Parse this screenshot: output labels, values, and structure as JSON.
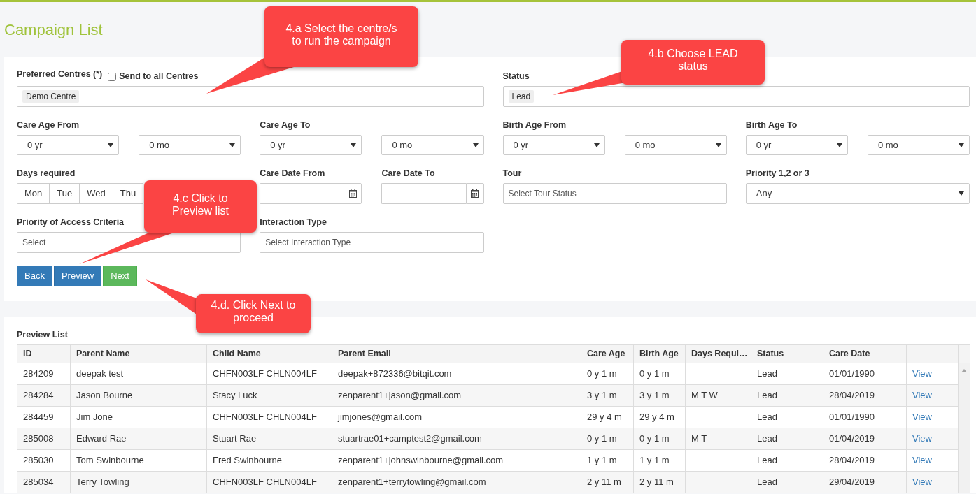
{
  "page": {
    "title": "Campaign List"
  },
  "filters": {
    "centres": {
      "label": "Preferred Centres (*)",
      "send_to_all": {
        "label": "Send to all Centres",
        "checked": false
      },
      "tags": [
        "Demo Centre"
      ]
    },
    "status": {
      "label": "Status",
      "tags": [
        "Lead"
      ]
    },
    "age_ranges": [
      {
        "label": "Care Age From",
        "years": "0 yr",
        "months": "0 mo"
      },
      {
        "label": "Care Age To",
        "years": "0 yr",
        "months": "0 mo"
      },
      {
        "label": "Birth Age From",
        "years": "0 yr",
        "months": "0 mo"
      },
      {
        "label": "Birth Age To",
        "years": "0 yr",
        "months": "0 mo"
      }
    ],
    "days_required": {
      "label": "Days required",
      "days": [
        {
          "label": "Mon",
          "selected": false
        },
        {
          "label": "Tue",
          "selected": false
        },
        {
          "label": "Wed",
          "selected": false
        },
        {
          "label": "Thu",
          "selected": false
        }
      ]
    },
    "care_dates": [
      {
        "label": "Care Date From"
      },
      {
        "label": "Care Date To"
      }
    ],
    "tour": {
      "label": "Tour",
      "placeholder": "Select Tour Status"
    },
    "priority": {
      "label": "Priority 1,2 or 3",
      "value": "Any"
    },
    "access_criteria": {
      "label": "Priority of Access Criteria",
      "placeholder": "Select"
    },
    "interaction_type": {
      "label": "Interaction Type",
      "placeholder": "Select Interaction Type"
    }
  },
  "buttons": [
    {
      "label": "Back",
      "kind": "primary"
    },
    {
      "label": "Preview",
      "kind": "primary"
    },
    {
      "label": "Next",
      "kind": "success"
    }
  ],
  "preview": {
    "title": "Preview List",
    "columns": [
      "ID",
      "Parent Name",
      "Child Name",
      "Parent Email",
      "Care Age",
      "Birth Age",
      "Days Requi…",
      "Status",
      "Care Date"
    ],
    "rows": [
      {
        "id": "284209",
        "parent_name": "deepak test",
        "child_name": "CHFN003LF CHLN004LF",
        "parent_email": "deepak+872336@bitqit.com",
        "care_age": "0 y 1 m",
        "birth_age": "0 y 1 m",
        "status": "Lead",
        "care_date": "01/01/1990",
        "link": "View"
      },
      {
        "id": "284284",
        "parent_name": "Jason Bourne",
        "child_name": "Stacy Luck",
        "parent_email": "zenparent1+jason@gmail.com",
        "care_age": "3 y 1 m",
        "birth_age": "3 y 1 m",
        "days_required": "M T W",
        "status": "Lead",
        "care_date": "28/04/2019",
        "link": "View"
      },
      {
        "id": "284459",
        "parent_name": "Jim Jone",
        "child_name": "CHFN003LF CHLN004LF",
        "parent_email": "jimjones@gmail.com",
        "care_age": "29 y 4 m",
        "birth_age": "29 y 4 m",
        "status": "Lead",
        "care_date": "01/01/1990",
        "link": "View"
      },
      {
        "id": "285008",
        "parent_name": "Edward Rae",
        "child_name": "Stuart Rae",
        "parent_email": "stuartrae01+camptest2@gmail.com",
        "care_age": "0 y 1 m",
        "birth_age": "0 y 1 m",
        "days_required": "M T",
        "status": "Lead",
        "care_date": "01/04/2019",
        "link": "View"
      },
      {
        "id": "285030",
        "parent_name": "Tom Swinbourne",
        "child_name": "Fred Swinbourne",
        "parent_email": "zenparent1+johnswinbourne@gmail.com",
        "care_age": "1 y 1 m",
        "birth_age": "1 y 1 m",
        "status": "Lead",
        "care_date": "28/04/2019",
        "link": "View"
      },
      {
        "id": "285034",
        "parent_name": "Terry Towling",
        "child_name": "CHFN003LF CHLN004LF",
        "parent_email": "zenparent1+terrytowling@gmail.com",
        "care_age": "2 y 11 m",
        "birth_age": "2 y 11 m",
        "status": "Lead",
        "care_date": "29/04/2019",
        "link": "View"
      }
    ]
  },
  "callouts": [
    {
      "lines": [
        "4.a Select the centre/s",
        "to run the campaign"
      ]
    },
    {
      "lines": [
        "4.b Choose LEAD",
        "status"
      ]
    },
    {
      "lines": [
        "4.c Click to",
        "Preview list"
      ]
    },
    {
      "lines": [
        "4.d. Click Next to",
        "proceed"
      ]
    }
  ]
}
